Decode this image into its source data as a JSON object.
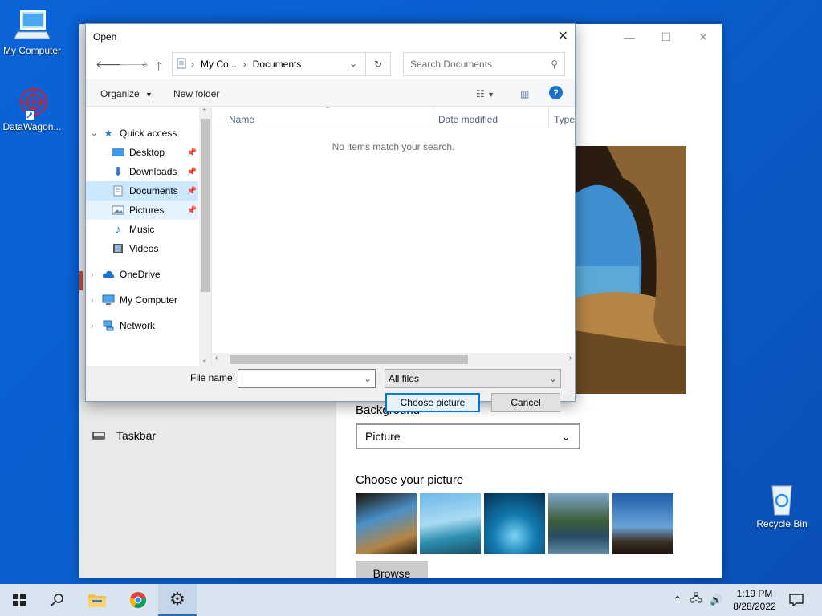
{
  "desktop": {
    "icons": [
      {
        "label": "My Computer"
      },
      {
        "label": "DataWagon..."
      },
      {
        "label": "Recycle Bin"
      }
    ]
  },
  "settings": {
    "taskbar_item": "Taskbar",
    "background_label": "Background",
    "background_value": "Picture",
    "choose_label": "Choose your picture",
    "browse_label": "Browse"
  },
  "dialog": {
    "title": "Open",
    "address": {
      "crumb1": "My Co...",
      "crumb2": "Documents"
    },
    "search_placeholder": "Search Documents",
    "organize": "Organize",
    "new_folder": "New folder",
    "nav": {
      "quick_access": "Quick access",
      "desktop": "Desktop",
      "downloads": "Downloads",
      "documents": "Documents",
      "pictures": "Pictures",
      "music": "Music",
      "videos": "Videos",
      "onedrive": "OneDrive",
      "mycomputer": "My Computer",
      "network": "Network"
    },
    "columns": {
      "name": "Name",
      "date": "Date modified",
      "type": "Type"
    },
    "empty_message": "No items match your search.",
    "file_name_label": "File name:",
    "file_name_value": "",
    "file_type": "All files",
    "choose_button": "Choose picture",
    "cancel_button": "Cancel"
  },
  "taskbar": {
    "time": "1:19 PM",
    "date": "8/28/2022"
  },
  "colors": {
    "desktop": "#0a5fd0",
    "accent": "#0078d7",
    "selection": "#cce8ff"
  }
}
